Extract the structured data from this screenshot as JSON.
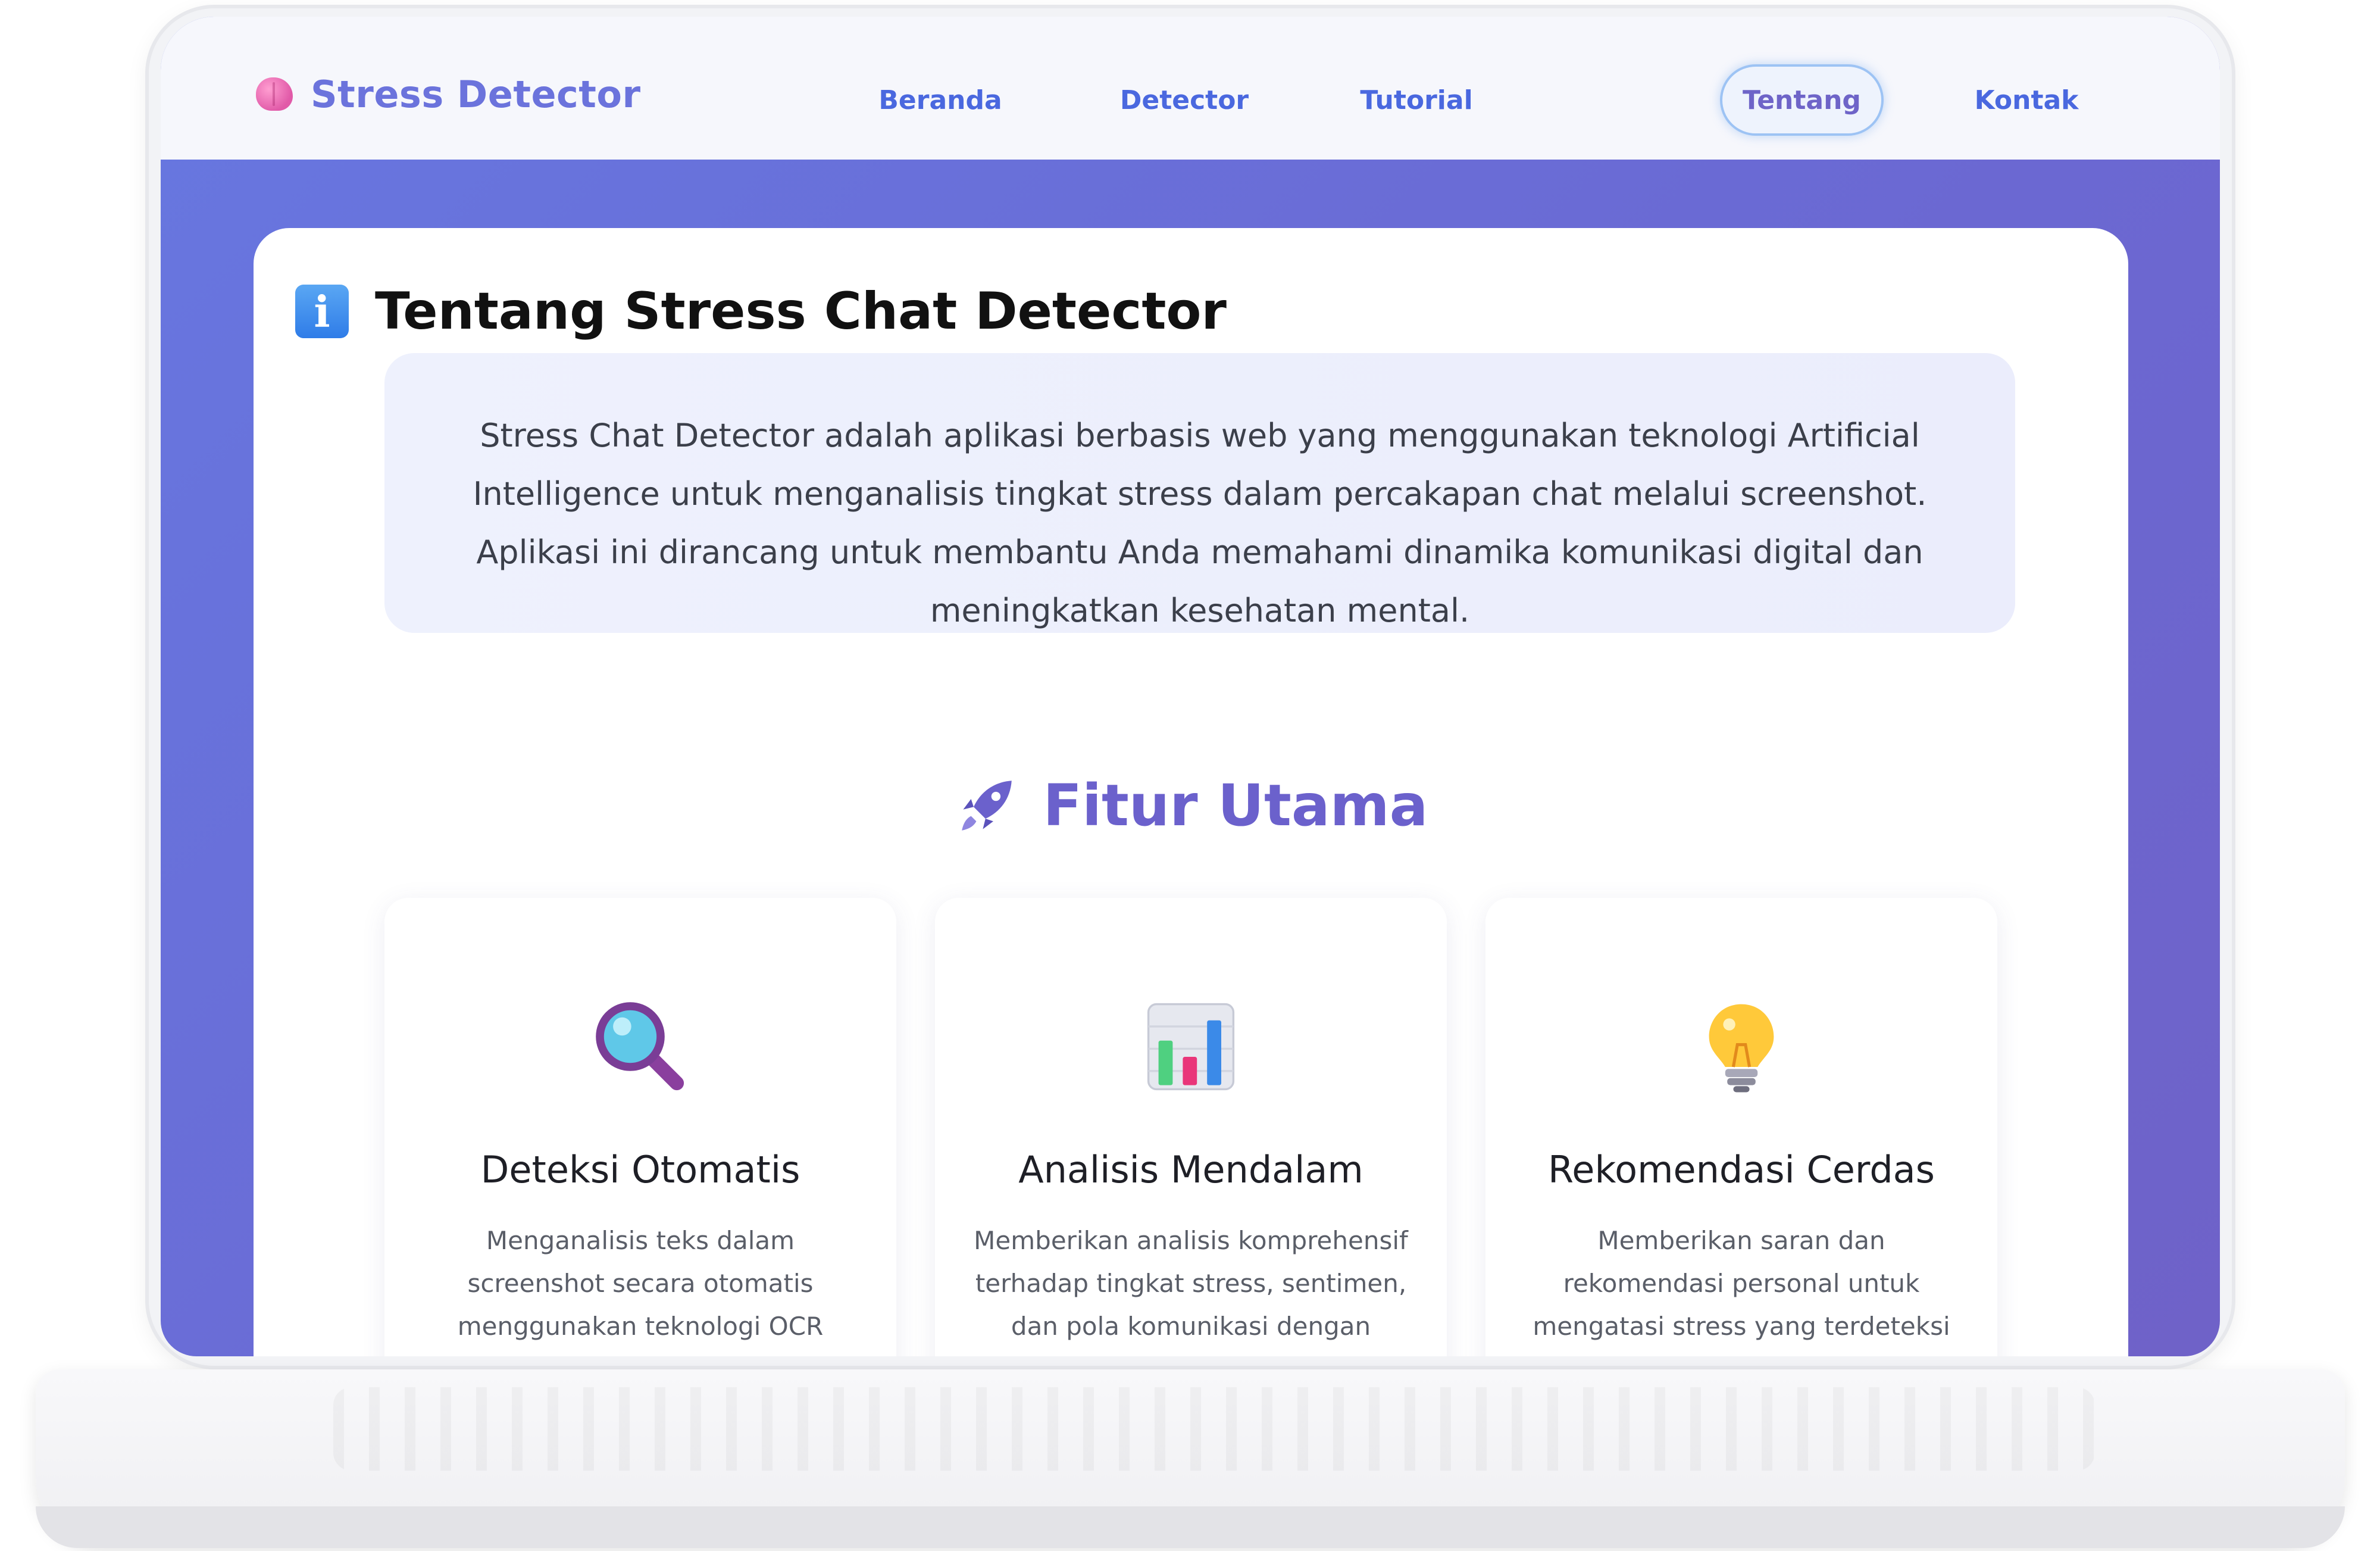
{
  "navbar": {
    "brand": "Stress Detector",
    "items": [
      {
        "label": "Beranda"
      },
      {
        "label": "Detector"
      },
      {
        "label": "Tutorial"
      },
      {
        "label": "Tentang"
      },
      {
        "label": "Kontak"
      }
    ],
    "active_item": "Tentang"
  },
  "about": {
    "title": "Tentang Stress Chat Detector",
    "description": "Stress Chat Detector adalah aplikasi berbasis web yang menggunakan teknologi Artificial Intelligence untuk menganalisis tingkat stress dalam percakapan chat melalui screenshot. Aplikasi ini dirancang untuk membantu Anda memahami dinamika komunikasi digital dan meningkatkan kesehatan mental."
  },
  "features": {
    "title": "Fitur Utama",
    "items": [
      {
        "icon": "magnifier-icon",
        "title": "Deteksi Otomatis",
        "description": "Menganalisis teks dalam screenshot secara otomatis menggunakan teknologi OCR canggih dan AI"
      },
      {
        "icon": "bar-chart-icon",
        "title": "Analisis Mendalam",
        "description": "Memberikan analisis komprehensif terhadap tingkat stress, sentimen, dan pola komunikasi dengan"
      },
      {
        "icon": "lightbulb-icon",
        "title": "Rekomendasi Cerdas",
        "description": "Memberikan saran dan rekomendasi personal untuk mengatasi stress yang terdeteksi"
      }
    ]
  },
  "colors": {
    "brand": "#6b73dc",
    "nav_link": "#4a68df",
    "hero_gradient_start": "#6777e0",
    "hero_gradient_end": "#6f62c8",
    "section_title": "#6b61cc"
  }
}
